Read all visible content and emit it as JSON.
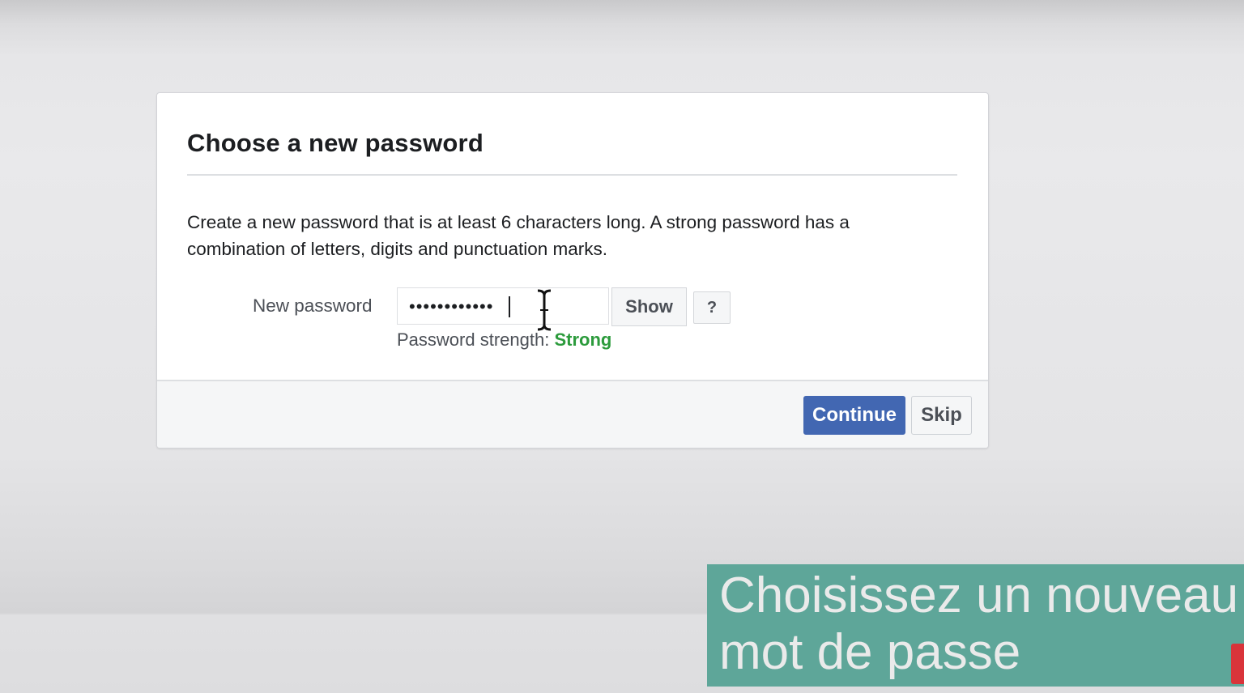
{
  "dialog": {
    "title": "Choose a new password",
    "description": "Create a new password that is at least 6 characters long. A strong password has a combination of letters, digits and punctuation marks.",
    "field_label": "New password",
    "password_value": "••••••••••••",
    "show_label": "Show",
    "help_label": "?",
    "strength_label": "Password strength:",
    "strength_value": "Strong"
  },
  "footer": {
    "continue_label": "Continue",
    "skip_label": "Skip"
  },
  "caption": {
    "text": "Choisissez un nouveau\nmot de passe"
  },
  "colors": {
    "primary_button": "#4267b2",
    "strength_strong": "#2c9b3c",
    "caption_background": "#5ea699"
  },
  "icons": {
    "cursor": "text-cursor-icon",
    "corner": "channel-badge-icon"
  }
}
